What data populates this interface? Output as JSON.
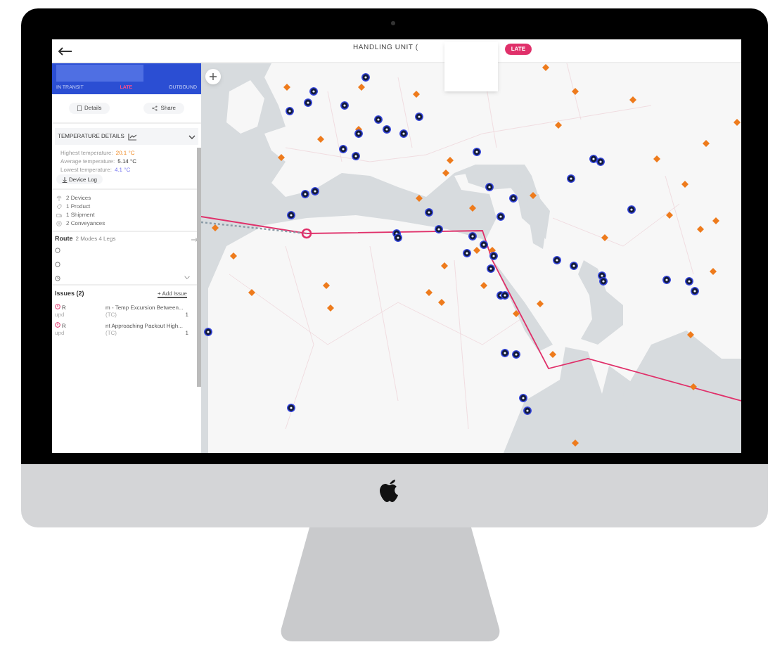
{
  "header": {
    "title": "HANDLING UNIT (",
    "status": "LATE"
  },
  "sidebar": {
    "steps": [
      {
        "label": "IN TRANSIT",
        "selected": false
      },
      {
        "label": "LATE",
        "selected": true
      },
      {
        "label": "OUTBOUND",
        "selected": false
      }
    ],
    "actions": [
      {
        "label": "Details",
        "kind": "details"
      },
      {
        "label": "Share",
        "kind": "share"
      }
    ],
    "temperature": {
      "title": "TEMPERATURE DETAILS",
      "expanded": true,
      "readings": [
        {
          "label": "Highest temperature:",
          "value": "20.1 °C",
          "kind": "high"
        },
        {
          "label": "Average temperature:",
          "value": "5.14 °C",
          "kind": "average"
        },
        {
          "label": "Lowest temperature:",
          "value": "4.1 °C",
          "kind": "low"
        }
      ],
      "device_log": "Device Log"
    },
    "summary": [
      {
        "label": "2 Devices",
        "kind": "device"
      },
      {
        "label": "1 Product",
        "kind": "product"
      },
      {
        "label": "1 Shipment",
        "kind": "shipment"
      },
      {
        "label": "2 Conveyances",
        "kind": "conveyance"
      }
    ],
    "route": {
      "title": "Route",
      "detail": "2 Modes 4 Legs"
    },
    "issues": {
      "title": "Issues (2)",
      "add": "+ Add Issue",
      "items": [
        {
          "code": "R",
          "updated": "upd",
          "title": "m - Temp Excursion Between...",
          "ref": "(TC)",
          "comments": "1"
        },
        {
          "code": "R",
          "updated": "upd",
          "title": "nt Approaching Packout High...",
          "ref": "(TC)",
          "comments": "1"
        }
      ]
    }
  }
}
